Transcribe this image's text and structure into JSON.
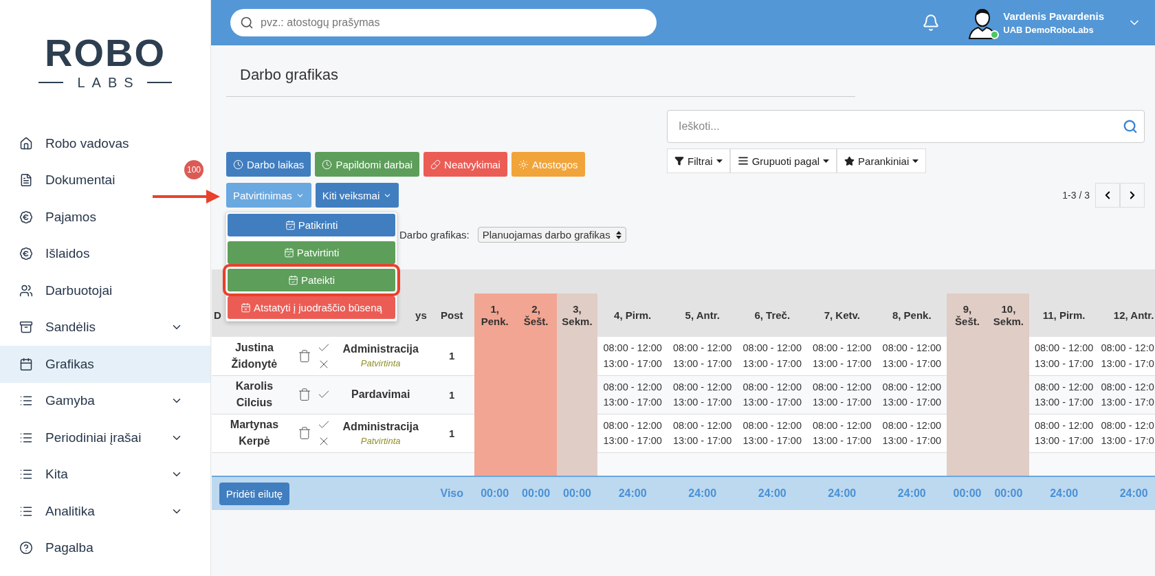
{
  "sidebar": {
    "logo": {
      "top": "ROBO",
      "bottom": "LABS"
    },
    "items": [
      {
        "kind": "home",
        "label": "Robo vadovas",
        "selected": false,
        "expandable": false
      },
      {
        "kind": "document",
        "label": "Dokumentai",
        "badge": "100",
        "selected": false,
        "expandable": false
      },
      {
        "kind": "income",
        "label": "Pajamos",
        "selected": false,
        "expandable": false
      },
      {
        "kind": "expense",
        "label": "Išlaidos",
        "selected": false,
        "expandable": false
      },
      {
        "kind": "people",
        "label": "Darbuotojai",
        "selected": false,
        "expandable": false
      },
      {
        "kind": "archive",
        "label": "Sandėlis",
        "selected": false,
        "expandable": true
      },
      {
        "kind": "calendar",
        "label": "Grafikas",
        "selected": true,
        "expandable": false
      },
      {
        "kind": "list",
        "label": "Gamyba",
        "selected": false,
        "expandable": true
      },
      {
        "kind": "list",
        "label": "Periodiniai įrašai",
        "selected": false,
        "expandable": true
      },
      {
        "kind": "list",
        "label": "Kita",
        "selected": false,
        "expandable": true
      },
      {
        "kind": "list",
        "label": "Analitika",
        "selected": false,
        "expandable": true
      },
      {
        "kind": "help",
        "label": "Pagalba",
        "selected": false,
        "expandable": false
      }
    ]
  },
  "topbar": {
    "search_placeholder": "pvz.: atostogų prašymas",
    "user": {
      "name": "Vardenis Pavardenis",
      "company": "UAB DemoRoboLabs",
      "online": true
    }
  },
  "page": {
    "title": "Darbo grafikas"
  },
  "search": {
    "placeholder": "Ieškoti..."
  },
  "filter_buttons": [
    {
      "kind": "filter",
      "label": "Filtrai"
    },
    {
      "kind": "group",
      "label": "Grupuoti pagal"
    },
    {
      "kind": "favorites",
      "label": "Parankiniai"
    }
  ],
  "pager": {
    "range": "1-3 / 3"
  },
  "action_buttons": [
    {
      "kind": "time",
      "label": "Darbo laikas",
      "color": "#407ec0"
    },
    {
      "kind": "time",
      "label": "Papildomi darbai",
      "color": "#5d9e5a"
    },
    {
      "kind": "absence",
      "label": "Neatvykimai",
      "color": "#eb5c55"
    },
    {
      "kind": "vacation",
      "label": "Atostogos",
      "color": "#f0a43a"
    }
  ],
  "menu_buttons": [
    {
      "label": "Patvirtinimas",
      "expanded": true
    },
    {
      "label": "Kiti veiksmai",
      "expanded": false
    }
  ],
  "dropdown": [
    {
      "kind": "confirm",
      "label": "Patikrinti",
      "color": "#407ec0",
      "highlighted": false
    },
    {
      "kind": "confirm",
      "label": "Patvirtinti",
      "color": "#5d9e5a",
      "highlighted": false
    },
    {
      "kind": "confirm",
      "label": "Pateikti",
      "color": "#5d9e5a",
      "highlighted": true
    },
    {
      "kind": "reset",
      "label": "Atstatyti į juodraščio būseną",
      "color": "#eb5c55",
      "highlighted": false
    }
  ],
  "schedule_select": {
    "label": "Darbo grafikas:",
    "value": "Planuojamas darbo grafikas"
  },
  "table": {
    "fixed_columns": [
      {
        "kind": "name",
        "label": "D"
      },
      {
        "kind": "actions"
      },
      {
        "kind": "department",
        "label": "ys"
      },
      {
        "kind": "post",
        "label": "Post"
      }
    ],
    "days": [
      {
        "label": "1, Penk.",
        "kind": "holiday",
        "total": "00:00"
      },
      {
        "label": "2, Šešt.",
        "kind": "holiday",
        "total": "00:00"
      },
      {
        "label": "3, Sekm.",
        "kind": "weekend",
        "total": "00:00"
      },
      {
        "label": "4, Pirm.",
        "kind": "workday",
        "total": "24:00"
      },
      {
        "label": "5, Antr.",
        "kind": "workday",
        "total": "24:00"
      },
      {
        "label": "6, Treč.",
        "kind": "workday",
        "total": "24:00"
      },
      {
        "label": "7, Ketv.",
        "kind": "workday",
        "total": "24:00"
      },
      {
        "label": "8, Penk.",
        "kind": "workday",
        "total": "24:00"
      },
      {
        "label": "9, Šešt.",
        "kind": "weekend",
        "total": "00:00"
      },
      {
        "label": "10, Sekm.",
        "kind": "weekend",
        "total": "00:00"
      },
      {
        "label": "11, Pirm.",
        "kind": "workday",
        "total": "24:00"
      },
      {
        "label": "12, Antr.",
        "kind": "workday",
        "total": "24:00"
      }
    ],
    "rows": [
      {
        "name": "Justina Židonytė",
        "rejectable": true,
        "department": "Administracija",
        "status": "Patvirtinta",
        "post": "1",
        "shifts": [
          [
            "08:00 - 12:00",
            "13:00 - 17:00"
          ],
          [
            "08:00 - 12:00",
            "13:00 - 17:00"
          ],
          [
            "08:00 - 12:00",
            "13:00 - 17:00"
          ],
          [
            "08:00 - 12:00",
            "13:00 - 17:00"
          ],
          [
            "08:00 - 12:00",
            "13:00 - 17:00"
          ],
          [
            "08:00 - 12:00",
            "13:00 - 17:00"
          ],
          [
            "08:00 - 12:0",
            "13:00 - 17:0"
          ]
        ]
      },
      {
        "name": "Karolis Cilcius",
        "rejectable": false,
        "department": "Pardavimai",
        "post": "1",
        "shifts": [
          [
            "08:00 - 12:00",
            "13:00 - 17:00"
          ],
          [
            "08:00 - 12:00",
            "13:00 - 17:00"
          ],
          [
            "08:00 - 12:00",
            "13:00 - 17:00"
          ],
          [
            "08:00 - 12:00",
            "13:00 - 17:00"
          ],
          [
            "08:00 - 12:00",
            "13:00 - 17:00"
          ],
          [
            "08:00 - 12:00",
            "13:00 - 17:00"
          ],
          [
            "08:00 - 12:0",
            "13:00 - 17:0"
          ]
        ]
      },
      {
        "name": "Martynas Kerpė",
        "rejectable": true,
        "department": "Administracija",
        "status": "Patvirtinta",
        "post": "1",
        "shifts": [
          [
            "08:00 - 12:00",
            "13:00 - 17:00"
          ],
          [
            "08:00 - 12:00",
            "13:00 - 17:00"
          ],
          [
            "08:00 - 12:00",
            "13:00 - 17:00"
          ],
          [
            "08:00 - 12:00",
            "13:00 - 17:00"
          ],
          [
            "08:00 - 12:00",
            "13:00 - 17:00"
          ],
          [
            "08:00 - 12:00",
            "13:00 - 17:00"
          ],
          [
            "08:00 - 12:0",
            "13:00 - 17:0"
          ]
        ]
      }
    ],
    "footer": {
      "add_row": "Pridėti eilutę",
      "total_label": "Viso"
    }
  }
}
